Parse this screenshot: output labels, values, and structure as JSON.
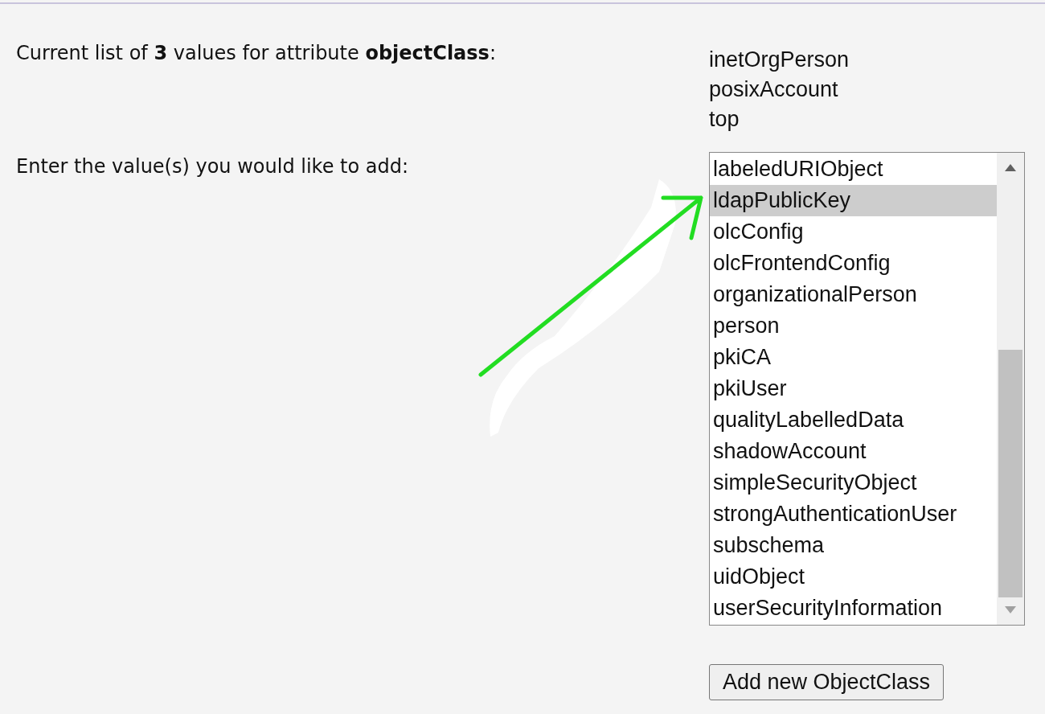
{
  "current": {
    "label": "Current list of **3** values for attribute **objectClass**:",
    "values": [
      "inetOrgPerson",
      "posixAccount",
      "top"
    ]
  },
  "add": {
    "label": "Enter the value(s) you would like to add:",
    "options": [
      {
        "label": "labeledURIObject",
        "selected": false
      },
      {
        "label": "ldapPublicKey",
        "selected": true
      },
      {
        "label": "olcConfig",
        "selected": false
      },
      {
        "label": "olcFrontendConfig",
        "selected": false
      },
      {
        "label": "organizationalPerson",
        "selected": false
      },
      {
        "label": "person",
        "selected": false
      },
      {
        "label": "pkiCA",
        "selected": false
      },
      {
        "label": "pkiUser",
        "selected": false
      },
      {
        "label": "qualityLabelledData",
        "selected": false
      },
      {
        "label": "shadowAccount",
        "selected": false
      },
      {
        "label": "simpleSecurityObject",
        "selected": false
      },
      {
        "label": "strongAuthenticationUser",
        "selected": false
      },
      {
        "label": "subschema",
        "selected": false
      },
      {
        "label": "uidObject",
        "selected": false
      },
      {
        "label": "userSecurityInformation",
        "selected": false
      }
    ]
  },
  "button": "Add new ObjectClass"
}
